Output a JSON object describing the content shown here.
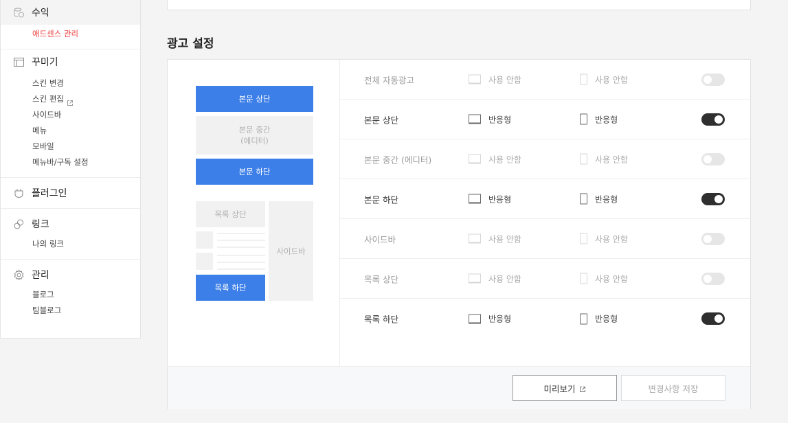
{
  "sidebar": {
    "groups": [
      {
        "title": "수익",
        "icon": "revenue-icon",
        "items": [
          "애드센스 관리"
        ]
      },
      {
        "title": "꾸미기",
        "icon": "layout-icon",
        "items": [
          "스킨 변경",
          "스킨 편집",
          "사이드바",
          "메뉴",
          "모바일",
          "메뉴바/구독 설정"
        ]
      },
      {
        "title": "플러그인",
        "icon": "plugin-icon",
        "items": []
      },
      {
        "title": "링크",
        "icon": "link-icon",
        "items": [
          "나의 링크"
        ]
      },
      {
        "title": "관리",
        "icon": "gear-icon",
        "items": [
          "블로그",
          "팀블로그"
        ]
      }
    ]
  },
  "section_title": "광고 설정",
  "preview": {
    "body_top": "본문 상단",
    "body_middle_line1": "본문 중간",
    "body_middle_line2": "(에디터)",
    "body_bottom": "본문 하단",
    "list_top": "목록 상단",
    "sidebar": "사이드바",
    "list_bottom": "목록 하단"
  },
  "rows": [
    {
      "name": "전체 자동광고",
      "pc": "사용 안함",
      "mobile": "사용 안함",
      "enabled": false
    },
    {
      "name": "본문 상단",
      "pc": "반응형",
      "mobile": "반응형",
      "enabled": true
    },
    {
      "name": "본문 중간 (에디터)",
      "pc": "사용 안함",
      "mobile": "사용 안함",
      "enabled": false
    },
    {
      "name": "본문 하단",
      "pc": "반응형",
      "mobile": "반응형",
      "enabled": true
    },
    {
      "name": "사이드바",
      "pc": "사용 안함",
      "mobile": "사용 안함",
      "enabled": false
    },
    {
      "name": "목록 상단",
      "pc": "사용 안함",
      "mobile": "사용 안함",
      "enabled": false
    },
    {
      "name": "목록 하단",
      "pc": "반응형",
      "mobile": "반응형",
      "enabled": true
    }
  ],
  "buttons": {
    "preview": "미리보기",
    "save": "변경사항 저장"
  },
  "colors": {
    "accent_blue": "#3d7fe8",
    "active_red": "#ee4040",
    "toggle_on": "#2f2f2f"
  }
}
